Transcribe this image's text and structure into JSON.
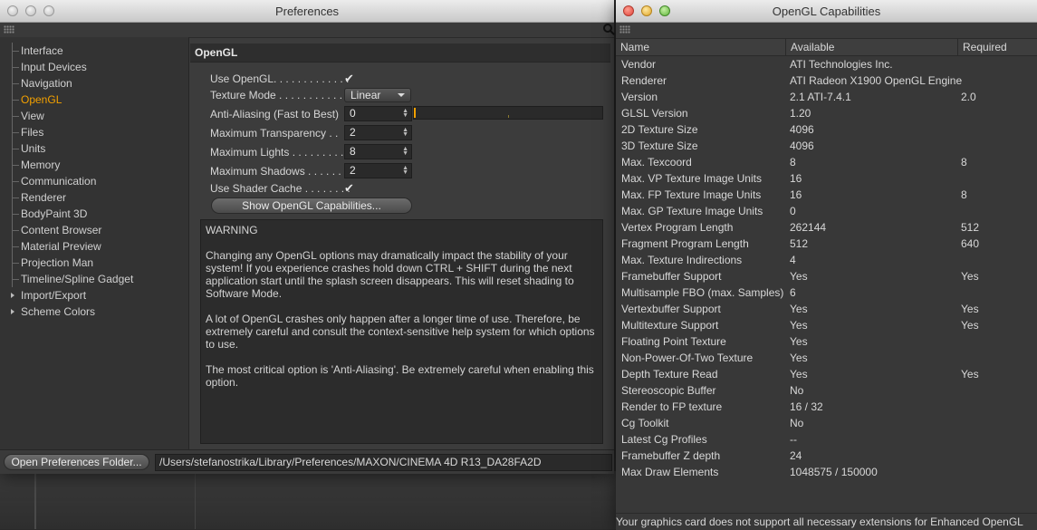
{
  "prefs": {
    "title": "Preferences",
    "sidebar": {
      "items": [
        {
          "label": "Interface"
        },
        {
          "label": "Input Devices"
        },
        {
          "label": "Navigation"
        },
        {
          "label": "OpenGL"
        },
        {
          "label": "View"
        },
        {
          "label": "Files"
        },
        {
          "label": "Units"
        },
        {
          "label": "Memory"
        },
        {
          "label": "Communication"
        },
        {
          "label": "Renderer"
        },
        {
          "label": "BodyPaint 3D"
        },
        {
          "label": "Content Browser"
        },
        {
          "label": "Material Preview"
        },
        {
          "label": "Projection Man"
        },
        {
          "label": "Timeline/Spline Gadget"
        },
        {
          "label": "Import/Export"
        },
        {
          "label": "Scheme Colors"
        }
      ],
      "active_item": "OpenGL"
    },
    "panel": {
      "heading": "OpenGL",
      "use_opengl": {
        "label": "Use OpenGL. . . . . . . . . . . . .",
        "checked": "✔"
      },
      "texture_mode": {
        "label": "Texture Mode . . . . . . . . . . .",
        "value": "Linear"
      },
      "anti_aliasing": {
        "label": "Anti-Aliasing (Fast to Best)",
        "value": "0"
      },
      "max_transparency": {
        "label": "Maximum Transparency . .",
        "value": "2"
      },
      "max_lights": {
        "label": "Maximum Lights . . . . . . . . .",
        "value": "8"
      },
      "max_shadows": {
        "label": "Maximum Shadows . . . . . .",
        "value": "2"
      },
      "use_shader_cache": {
        "label": "Use Shader Cache . . . . . . . .",
        "checked": "✔"
      },
      "show_caps_button": "Show OpenGL Capabilities...",
      "warning": {
        "title": "WARNING",
        "p1": "Changing any OpenGL options may dramatically impact the stability of your system! If you experience crashes hold down CTRL + SHIFT during the next application start until the splash screen disappears. This will reset shading to Software Mode.",
        "p2": "A lot of OpenGL crashes only happen after a longer time of use. Therefore, be extremely careful and consult the context-sensitive help system for which options to use.",
        "p3": "The most critical option is 'Anti-Aliasing'. Be extremely careful when enabling this option."
      }
    },
    "bottom": {
      "open_folder_button": "Open Preferences Folder...",
      "path": "/Users/stefanostrika/Library/Preferences/MAXON/CINEMA 4D R13_DA28FA2D"
    }
  },
  "caps": {
    "title": "OpenGL Capabilities",
    "columns": {
      "name": "Name",
      "available": "Available",
      "required": "Required"
    },
    "rows": [
      {
        "name": "Vendor",
        "available": "ATI Technologies Inc.",
        "required": ""
      },
      {
        "name": "Renderer",
        "available": "ATI Radeon X1900 OpenGL Engine",
        "required": ""
      },
      {
        "name": "Version",
        "available": "2.1 ATI-7.4.1",
        "required": "2.0"
      },
      {
        "name": "GLSL Version",
        "available": "1.20",
        "required": ""
      },
      {
        "name": "2D Texture Size",
        "available": "4096",
        "required": ""
      },
      {
        "name": "3D Texture Size",
        "available": "4096",
        "required": ""
      },
      {
        "name": "Max. Texcoord",
        "available": "8",
        "required": "8"
      },
      {
        "name": "Max. VP Texture Image Units",
        "available": "16",
        "required": ""
      },
      {
        "name": "Max. FP Texture Image Units",
        "available": "16",
        "required": "8"
      },
      {
        "name": "Max. GP Texture Image Units",
        "available": "0",
        "required": ""
      },
      {
        "name": "Vertex Program Length",
        "available": "262144",
        "required": "512"
      },
      {
        "name": "Fragment Program Length",
        "available": "512",
        "required": "640"
      },
      {
        "name": "Max. Texture Indirections",
        "available": "4",
        "required": ""
      },
      {
        "name": "Framebuffer Support",
        "available": "Yes",
        "required": "Yes"
      },
      {
        "name": "Multisample FBO (max. Samples)",
        "available": "6",
        "required": ""
      },
      {
        "name": "Vertexbuffer Support",
        "available": "Yes",
        "required": "Yes"
      },
      {
        "name": "Multitexture Support",
        "available": "Yes",
        "required": "Yes"
      },
      {
        "name": "Floating Point Texture",
        "available": "Yes",
        "required": ""
      },
      {
        "name": "Non-Power-Of-Two Texture",
        "available": "Yes",
        "required": ""
      },
      {
        "name": "Depth Texture Read",
        "available": "Yes",
        "required": "Yes"
      },
      {
        "name": "Stereoscopic Buffer",
        "available": "No",
        "required": ""
      },
      {
        "name": "Render to FP texture",
        "available": "16 / 32",
        "required": ""
      },
      {
        "name": "Cg Toolkit",
        "available": "No",
        "required": ""
      },
      {
        "name": "Latest Cg Profiles",
        "available": "--",
        "required": ""
      },
      {
        "name": "Framebuffer Z depth",
        "available": "24",
        "required": ""
      },
      {
        "name": "Max Draw Elements",
        "available": "1048575 / 150000",
        "required": ""
      }
    ],
    "status": "Your graphics card does not support all necessary extensions for Enhanced OpenGL"
  },
  "colors": {
    "accent": "#f2a000",
    "panel_bg": "#3c3c3c",
    "text": "#d8d8d8"
  }
}
